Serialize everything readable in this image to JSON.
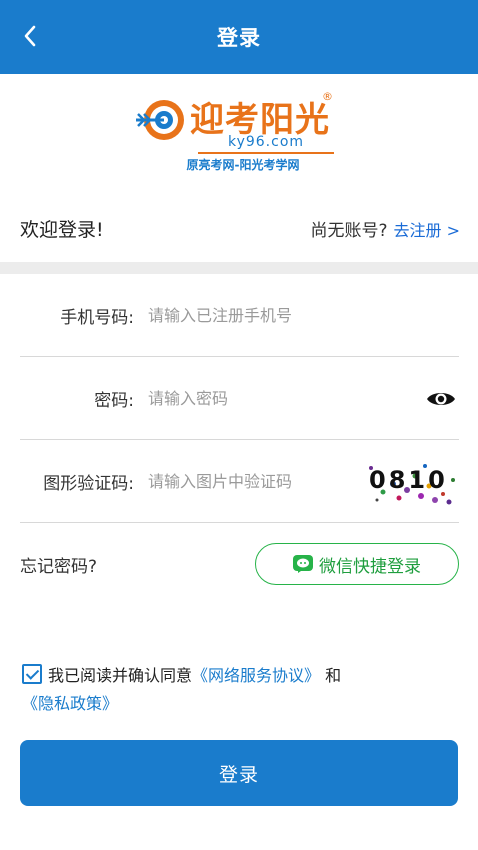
{
  "header": {
    "title": "登录"
  },
  "logo": {
    "name": "迎考阳光",
    "registered_mark": "®",
    "url": "ky96.com",
    "subtitle": "原亮考网-阳光考学网"
  },
  "welcome": {
    "text": "欢迎登录!",
    "no_account": "尚无账号?",
    "register_link": "去注册 >"
  },
  "form": {
    "phone": {
      "label": "手机号码:",
      "placeholder": "请输入已注册手机号",
      "value": ""
    },
    "password": {
      "label": "密码:",
      "placeholder": "请输入密码",
      "value": ""
    },
    "captcha": {
      "label": "图形验证码:",
      "placeholder": "请输入图片中验证码",
      "value": "",
      "captcha_text": "0810"
    }
  },
  "forgot_password": "忘记密码?",
  "wechat_login": "微信快捷登录",
  "agreement": {
    "checked": true,
    "prefix": "我已阅读并确认同意",
    "service_link": "《网络服务协议》",
    "and": "和",
    "privacy_link": "《隐私政策》"
  },
  "login_button": "登录",
  "colors": {
    "primary": "#1a7ccc",
    "wechat_green": "#27b349",
    "brand_orange": "#e8731a"
  },
  "icons": {
    "back": "chevron-left-icon",
    "eye": "eye-icon",
    "wechat": "wechat-icon"
  }
}
